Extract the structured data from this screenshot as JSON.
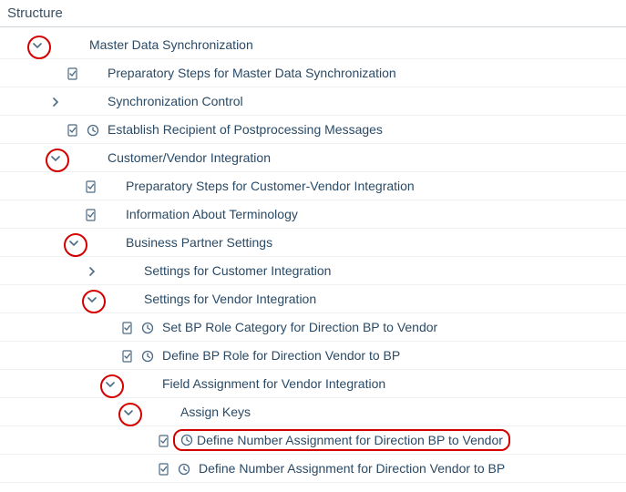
{
  "header": {
    "title": "Structure"
  },
  "tree": {
    "n0": {
      "label": "Master Data Synchronization"
    },
    "n1": {
      "label": "Preparatory Steps for Master Data Synchronization"
    },
    "n2": {
      "label": "Synchronization Control"
    },
    "n3": {
      "label": "Establish Recipient of Postprocessing Messages"
    },
    "n4": {
      "label": "Customer/Vendor Integration"
    },
    "n5": {
      "label": "Preparatory Steps for Customer-Vendor Integration"
    },
    "n6": {
      "label": "Information About Terminology"
    },
    "n7": {
      "label": "Business Partner Settings"
    },
    "n8": {
      "label": "Settings for Customer Integration"
    },
    "n9": {
      "label": "Settings for Vendor Integration"
    },
    "n10": {
      "label": "Set BP Role Category for Direction BP to Vendor"
    },
    "n11": {
      "label": "Define BP Role for Direction Vendor to BP"
    },
    "n12": {
      "label": "Field Assignment for Vendor Integration"
    },
    "n13": {
      "label": "Assign Keys"
    },
    "n14": {
      "label": "Define Number Assignment for Direction BP to Vendor"
    },
    "n15": {
      "label": "Define Number Assignment for Direction Vendor to BP"
    }
  }
}
